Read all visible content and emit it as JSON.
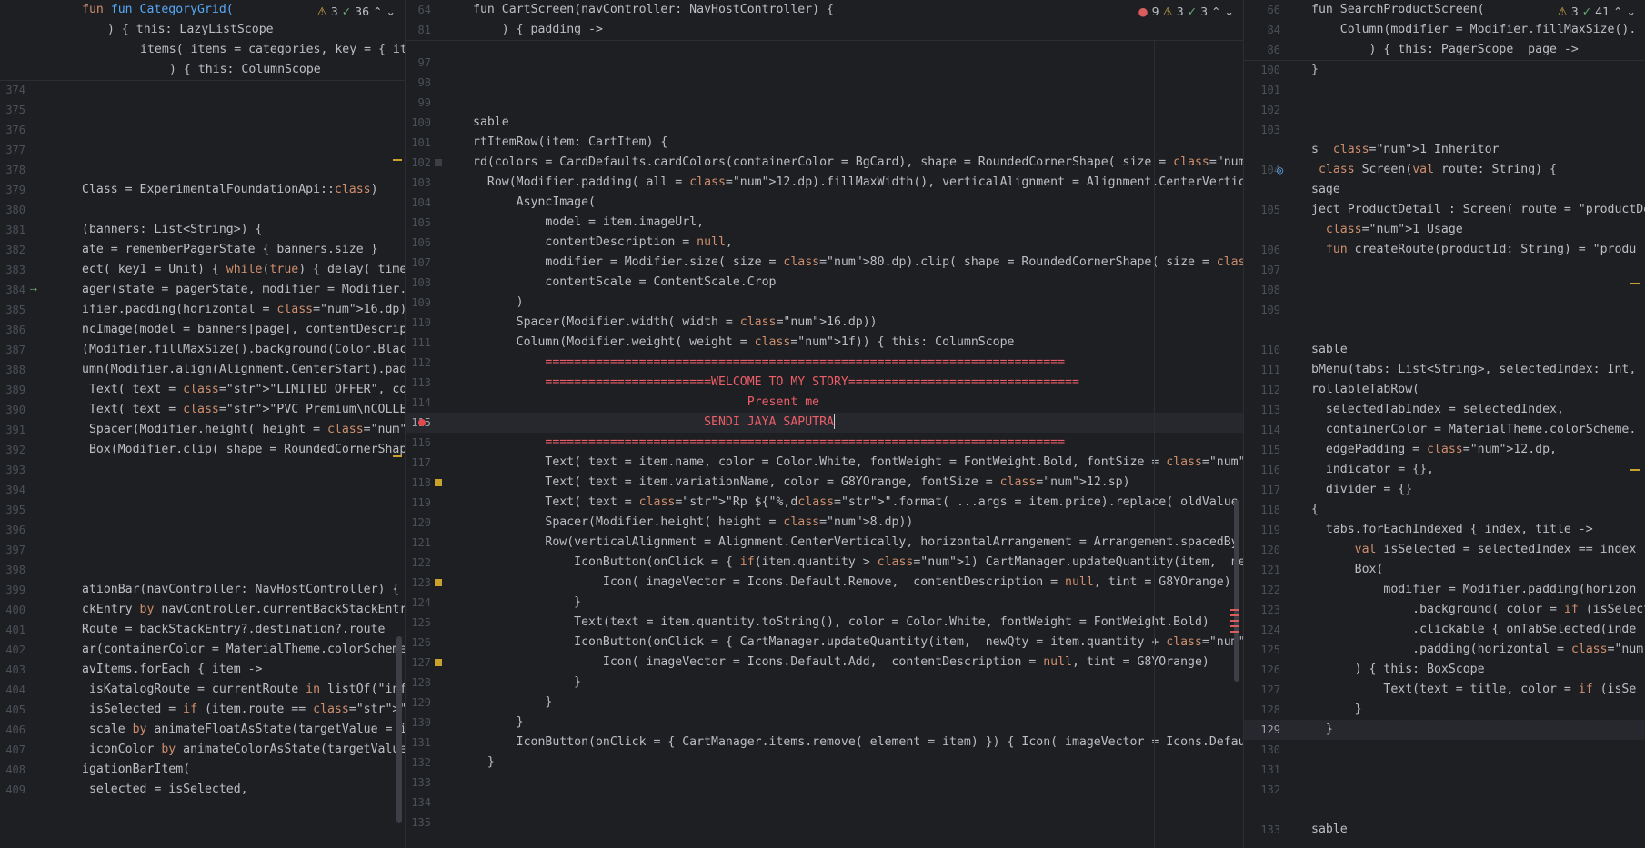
{
  "pane1": {
    "badges": {
      "warn": "3",
      "ok": "36"
    },
    "sticky": [
      "fun CategoryGrid(",
      ") { this: LazyListScope",
      "items( items = categories, key = { it.",
      ") { this: ColumnScope"
    ],
    "lines": [
      {
        "n": "374",
        "t": ""
      },
      {
        "n": "375",
        "t": ""
      },
      {
        "n": "376",
        "t": ""
      },
      {
        "n": "377",
        "t": ""
      },
      {
        "n": "378",
        "t": ""
      },
      {
        "n": "379",
        "t": "Class = ExperimentalFoundationApi::class)"
      },
      {
        "n": "380",
        "t": ""
      },
      {
        "n": "381",
        "t": "(banners: List<String>) {"
      },
      {
        "n": "382",
        "t": "ate = rememberPagerState { banners.size }"
      },
      {
        "n": "383",
        "t": "ect( key1 = Unit) { while(true) { delay( timeM"
      },
      {
        "n": "384",
        "t": "ager(state = pagerState, modifier = Modifier."
      },
      {
        "n": "385",
        "t": "ifier.padding(horizontal = 16.dp).clip( shape"
      },
      {
        "n": "386",
        "t": "ncImage(model = banners[page], contentDescrip"
      },
      {
        "n": "387",
        "t": "(Modifier.fillMaxSize().background(Color.Blac"
      },
      {
        "n": "388",
        "t": "umn(Modifier.align(Alignment.CenterStart).pad"
      },
      {
        "n": "389",
        "t": " Text( text = \"LIMITED OFFER\", color = Materia"
      },
      {
        "n": "390",
        "t": " Text( text = \"PVC Premium\\nCOLLECTION\", color"
      },
      {
        "n": "391",
        "t": " Spacer(Modifier.height( height = 12.dp))"
      },
      {
        "n": "392",
        "t": " Box(Modifier.clip( shape = RoundedCornerShape"
      },
      {
        "n": "393",
        "t": ""
      },
      {
        "n": "394",
        "t": ""
      },
      {
        "n": "395",
        "t": ""
      },
      {
        "n": "396",
        "t": ""
      },
      {
        "n": "397",
        "t": ""
      },
      {
        "n": "398",
        "t": ""
      },
      {
        "n": "399",
        "t": "ationBar(navController: NavHostController) {"
      },
      {
        "n": "400",
        "t": "ckEntry by navController.currentBackStackEntr"
      },
      {
        "n": "401",
        "t": "Route = backStackEntry?.destination?.route"
      },
      {
        "n": "402",
        "t": "ar(containerColor = MaterialTheme.colorScheme"
      },
      {
        "n": "403",
        "t": "avItems.forEach { item ->"
      },
      {
        "n": "404",
        "t": " isKatalogRoute = currentRoute in listOf(\"inf"
      },
      {
        "n": "405",
        "t": " isSelected = if (item.route == \"home\") curre"
      },
      {
        "n": "406",
        "t": " scale by animateFloatAsState(targetValue = i"
      },
      {
        "n": "407",
        "t": " iconColor by animateColorAsState(targetValue"
      },
      {
        "n": "408",
        "t": "igationBarItem("
      },
      {
        "n": "409",
        "t": " selected = isSelected,"
      }
    ]
  },
  "pane2": {
    "badges": {
      "err": "9",
      "warn": "3",
      "ok": "3"
    },
    "sticky": [
      {
        "n": "64",
        "t": "fun CartScreen(navController: NavHostController) {"
      },
      {
        "n": "81",
        "t": "    ) { padding ->"
      }
    ],
    "lines": [
      {
        "n": "97",
        "t": ""
      },
      {
        "n": "98",
        "t": ""
      },
      {
        "n": "99",
        "t": ""
      },
      {
        "n": "100",
        "t": "sable"
      },
      {
        "n": "101",
        "t": "rtItemRow(item: CartItem) {"
      },
      {
        "n": "102",
        "t": "rd(colors = CardDefaults.cardColors(containerColor = BgCard), shape = RoundedCornerShape( size = 16.dp)) { t"
      },
      {
        "n": "103",
        "t": "  Row(Modifier.padding( all = 12.dp).fillMaxWidth(), verticalAlignment = Alignment.CenterVertically) { this: R"
      },
      {
        "n": "104",
        "t": "      AsyncImage("
      },
      {
        "n": "105",
        "t": "          model = item.imageUrl,"
      },
      {
        "n": "106",
        "t": "          contentDescription = null,"
      },
      {
        "n": "107",
        "t": "          modifier = Modifier.size( size = 80.dp).clip( shape = RoundedCornerShape( size = 12.dp)),"
      },
      {
        "n": "108",
        "t": "          contentScale = ContentScale.Crop"
      },
      {
        "n": "109",
        "t": "      )"
      },
      {
        "n": "110",
        "t": "      Spacer(Modifier.width( width = 16.dp))"
      },
      {
        "n": "111",
        "t": "      Column(Modifier.weight( weight = 1f)) { this: ColumnScope"
      },
      {
        "n": "112",
        "t": "          ========================================================================"
      },
      {
        "n": "113",
        "t": "          =======================WELCOME TO MY STORY================================"
      },
      {
        "n": "114",
        "t": "                                      Present me"
      },
      {
        "n": "115",
        "t": "                                SENDI JAYA SAPUTRA"
      },
      {
        "n": "116",
        "t": "          ========================================================================"
      },
      {
        "n": "117",
        "t": "          Text( text = item.name, color = Color.White, fontWeight = FontWeight.Bold, fontSize = 16.sp)"
      },
      {
        "n": "118",
        "t": "          Text( text = item.variationName, color = G8YOrange, fontSize = 12.sp)"
      },
      {
        "n": "119",
        "t": "          Text( text = \"Rp ${\"%,d\".format( ...args = item.price).replace( oldValue = \",\",  newValue = \".\")}\", col"
      },
      {
        "n": "120",
        "t": "          Spacer(Modifier.height( height = 8.dp))"
      },
      {
        "n": "121",
        "t": "          Row(verticalAlignment = Alignment.CenterVertically, horizontalArrangement = Arrangement.spacedBy"
      },
      {
        "n": "122",
        "t": "              IconButton(onClick = { if(item.quantity > 1) CartManager.updateQuantity(item,  newQty = item"
      },
      {
        "n": "123",
        "t": "                  Icon( imageVector = Icons.Default.Remove,  contentDescription = null, tint = G8YOrange)"
      },
      {
        "n": "124",
        "t": "              }"
      },
      {
        "n": "125",
        "t": "              Text(text = item.quantity.toString(), color = Color.White, fontWeight = FontWeight.Bold)"
      },
      {
        "n": "126",
        "t": "              IconButton(onClick = { CartManager.updateQuantity(item,  newQty = item.quantity + 1) }, modif"
      },
      {
        "n": "127",
        "t": "                  Icon( imageVector = Icons.Default.Add,  contentDescription = null, tint = G8YOrange)"
      },
      {
        "n": "128",
        "t": "              }"
      },
      {
        "n": "129",
        "t": "          }"
      },
      {
        "n": "130",
        "t": "      }"
      },
      {
        "n": "131",
        "t": "      IconButton(onClick = { CartManager.items.remove( element = item) }) { Icon( imageVector = Icons.Default"
      },
      {
        "n": "132",
        "t": "  }"
      },
      {
        "n": "133",
        "t": ""
      },
      {
        "n": "134",
        "t": ""
      },
      {
        "n": "135",
        "t": ""
      }
    ]
  },
  "pane3": {
    "badges": {
      "warn": "3",
      "ok": "41"
    },
    "sticky": [
      {
        "n": "66",
        "t": "fun SearchProductScreen("
      },
      {
        "n": "84",
        "t": "    Column(modifier = Modifier.fillMaxSize()."
      },
      {
        "n": "86",
        "t": "        ) { this: PagerScope  page ->"
      }
    ],
    "lines": [
      {
        "n": "100",
        "t": "}"
      },
      {
        "n": "101",
        "t": ""
      },
      {
        "n": "102",
        "t": ""
      },
      {
        "n": "103",
        "t": ""
      },
      {
        "n": "",
        "t": "s  1 Inheritor"
      },
      {
        "n": "104",
        "t": " class Screen(val route: String) {"
      },
      {
        "n": "",
        "t": "sage"
      },
      {
        "n": "105",
        "t": "ject ProductDetail : Screen( route = \"productDe"
      },
      {
        "n": "",
        "t": "  1 Usage"
      },
      {
        "n": "106",
        "t": "  fun createRoute(productId: String) = \"produ"
      },
      {
        "n": "107",
        "t": ""
      },
      {
        "n": "108",
        "t": ""
      },
      {
        "n": "109",
        "t": ""
      },
      {
        "n": "",
        "t": ""
      },
      {
        "n": "110",
        "t": "sable"
      },
      {
        "n": "111",
        "t": "bMenu(tabs: List<String>, selectedIndex: Int,"
      },
      {
        "n": "112",
        "t": "rollableTabRow("
      },
      {
        "n": "113",
        "t": "  selectedTabIndex = selectedIndex,"
      },
      {
        "n": "114",
        "t": "  containerColor = MaterialTheme.colorScheme."
      },
      {
        "n": "115",
        "t": "  edgePadding = 12.dp,"
      },
      {
        "n": "116",
        "t": "  indicator = {},"
      },
      {
        "n": "117",
        "t": "  divider = {}"
      },
      {
        "n": "118",
        "t": "{"
      },
      {
        "n": "119",
        "t": "  tabs.forEachIndexed { index, title ->"
      },
      {
        "n": "120",
        "t": "      val isSelected = selectedIndex == index"
      },
      {
        "n": "121",
        "t": "      Box("
      },
      {
        "n": "122",
        "t": "          modifier = Modifier.padding(horizon"
      },
      {
        "n": "123",
        "t": "              .background( color = if (isSelect"
      },
      {
        "n": "124",
        "t": "              .clickable { onTabSelected(inde"
      },
      {
        "n": "125",
        "t": "              .padding(horizontal = 20.dp, ve"
      },
      {
        "n": "126",
        "t": "      ) { this: BoxScope"
      },
      {
        "n": "127",
        "t": "          Text(text = title, color = if (isSe"
      },
      {
        "n": "128",
        "t": "      }"
      },
      {
        "n": "129",
        "t": "  }"
      },
      {
        "n": "130",
        "t": ""
      },
      {
        "n": "131",
        "t": ""
      },
      {
        "n": "132",
        "t": ""
      },
      {
        "n": "",
        "t": ""
      },
      {
        "n": "133",
        "t": "sable"
      }
    ]
  },
  "colors": {
    "bg": "#1e1f22",
    "keyword": "#cf8e6d",
    "function": "#56a8f5",
    "string": "#6aab73",
    "number": "#2aacb8",
    "property": "#c77dbb",
    "warning": "#e0b34c",
    "error": "#db5c5c"
  }
}
